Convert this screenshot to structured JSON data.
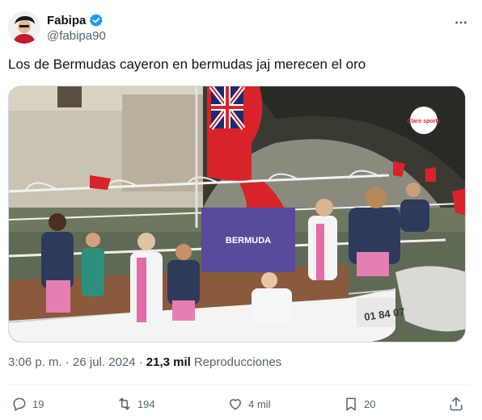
{
  "author": {
    "display_name": "Fabipa",
    "handle": "@fabipa90",
    "verified": true
  },
  "tweet": {
    "text": "Los de Bermudas cayeron en bermudas jaj merecen el oro",
    "timestamp": "3:06 p. m. · 26 jul. 2024 ·",
    "views_count": "21,3 mil",
    "views_label": "Reproducciones"
  },
  "media": {
    "flag_banner_text": "BERMUDA",
    "broadcaster_logo_text": "Claro sports",
    "hull_text": "01 84 07"
  },
  "actions": {
    "replies": "19",
    "reposts": "194",
    "likes": "4 mil",
    "bookmarks": "20"
  },
  "colors": {
    "accent": "#1d9bf0",
    "text_secondary": "#536471",
    "banner_purple": "#5a4a9c",
    "flag_red": "#d8232a"
  }
}
